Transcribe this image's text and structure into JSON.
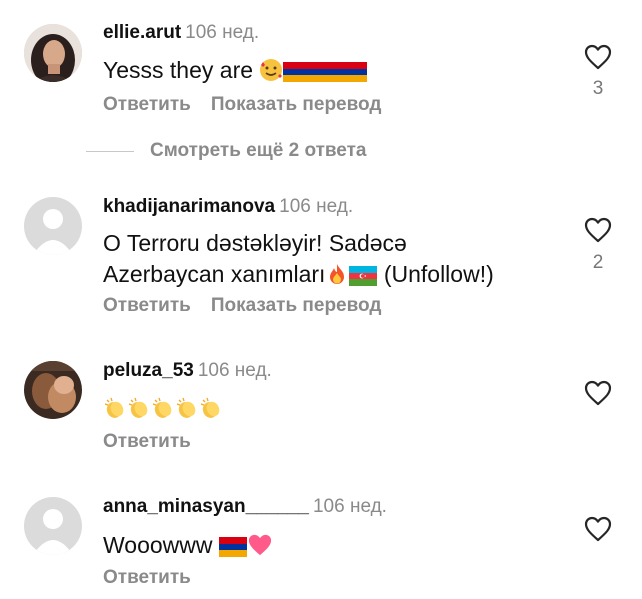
{
  "comments": [
    {
      "username": "ellie.arut",
      "time": "106 нед.",
      "text": "Yesss they are",
      "reply_label": "Ответить",
      "translate_label": "Показать перевод",
      "likes": "3",
      "avatar": "photo"
    },
    {
      "username": "khadijanarimanova",
      "time": "106 нед.",
      "text_line1": "O Terroru dəstəkləyir! Sadəcə",
      "text_line2": "Azerbaycan xanımları",
      "text_line2_end": "(Unfollow!)",
      "reply_label": "Ответить",
      "translate_label": "Показать перевод",
      "likes": "2",
      "avatar": "default"
    },
    {
      "username": "peluza_53",
      "time": "106 нед.",
      "reply_label": "Ответить",
      "avatar": "photo"
    },
    {
      "username": "anna_minasyan______",
      "time": "106 нед.",
      "text": "Wooowww",
      "reply_label": "Ответить",
      "avatar": "default"
    }
  ],
  "more_replies": "Смотреть ещё 2 ответа",
  "icons": {
    "like": "heart-outline-icon",
    "emoji_smiling_hearts": "smiling-face-with-hearts-emoji",
    "flag_armenia": "flag-armenia-emoji",
    "flag_azerbaijan": "flag-azerbaijan-emoji",
    "fire": "fire-emoji",
    "clap": "clapping-hands-emoji",
    "heart_pink": "pink-heart-emoji"
  },
  "colors": {
    "muted": "#8a8a8a",
    "text": "#111111",
    "default_avatar": "#dbdbdb"
  }
}
